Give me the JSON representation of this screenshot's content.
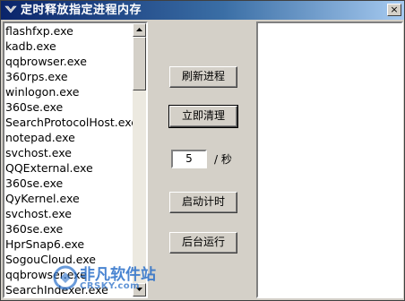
{
  "window": {
    "title": "定时释放指定进程内存",
    "close_label": "×"
  },
  "process_list": {
    "items": [
      "flashfxp.exe",
      "kadb.exe",
      "qqbrowser.exe",
      "360rps.exe",
      "winlogon.exe",
      "360se.exe",
      "SearchProtocolHost.exe",
      "notepad.exe",
      "svchost.exe",
      "QQExternal.exe",
      "360se.exe",
      "QyKernel.exe",
      "svchost.exe",
      "360se.exe",
      "HprSnap6.exe",
      "SogouCloud.exe",
      "qqbrowser.exe",
      "SearchIndexer.exe"
    ]
  },
  "buttons": {
    "refresh": "刷新进程",
    "clean_now": "立即清理",
    "start_timer": "启动计时",
    "run_background": "后台运行"
  },
  "interval": {
    "value": "5",
    "unit": "/ 秒"
  },
  "watermark": {
    "text": "非凡软件站",
    "sub": "CRSKY.com"
  },
  "colors": {
    "titlebar_start": "#0a246a",
    "titlebar_end": "#a6caf0",
    "face": "#d4d0c8",
    "watermark": "#2a6fc9"
  }
}
